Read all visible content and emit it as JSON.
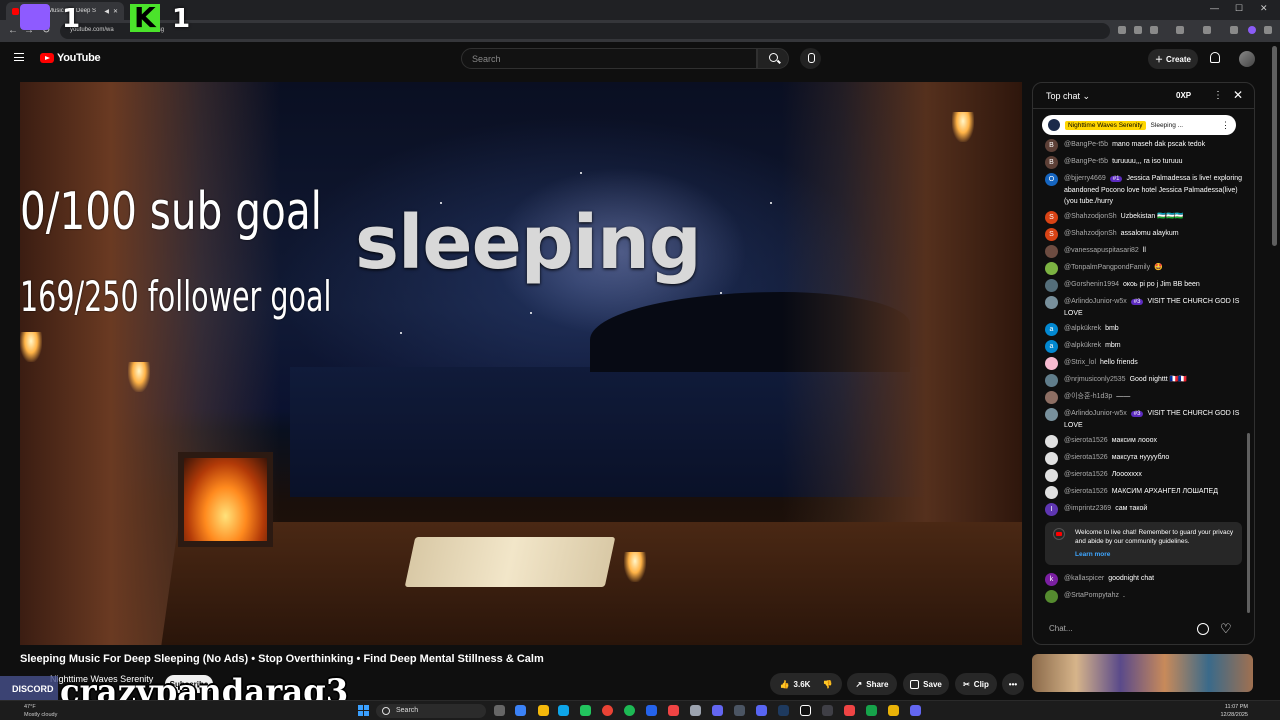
{
  "browser": {
    "tab_title": "Sleeping Music For Deep S",
    "url": "youtube.com/wa",
    "url_tail": "UCI-sg"
  },
  "youtube": {
    "logo": "YouTube",
    "search_placeholder": "Search",
    "create_label": "Create"
  },
  "stream_overlay": {
    "twitch_count": "1",
    "kick_count": "1",
    "sub_goal": "0/100 sub goal",
    "follower_goal": "169/250 follower goal",
    "headline": "sleeping",
    "username": "crazypandarag3",
    "discord_label": "DISCORD"
  },
  "video": {
    "title": "Sleeping Music For Deep Sleeping (No Ads) • Stop Overthinking • Find Deep Mental Stillness & Calm",
    "channel": "Nighttime Waves Serenity",
    "subscribe_label": "Subscribe",
    "likes": "3.6K",
    "share_label": "Share",
    "save_label": "Save",
    "clip_label": "Clip",
    "more_label": "•••"
  },
  "chat": {
    "title": "Top chat",
    "xp": "0XP",
    "pinned_name": "Nighttime Waves Serenity",
    "pinned_text": "Sleeping ...",
    "input_placeholder": "Chat...",
    "welcome_text": "Welcome to live chat! Remember to guard your privacy and abide by our community guidelines.",
    "learn_more": "Learn more",
    "messages": [
      {
        "author": "@BangPe-t5b",
        "text": "mano maseh dak pscak tedok",
        "initial": "B",
        "color": "#5d4037",
        "badge": ""
      },
      {
        "author": "@BangPe-t5b",
        "text": "turuuuu,,, ra iso turuuu",
        "initial": "B",
        "color": "#5d4037",
        "badge": ""
      },
      {
        "author": "@bjjerry4669",
        "text": "Jessica Palmadessa is live! exploring abandoned Pocono love hotel Jessica Palmadessa(live)(you tube./hurry",
        "initial": "O",
        "color": "#1565c0",
        "badge": "#1"
      },
      {
        "author": "@ShahzodjonSh",
        "text": "Uzbekistan 🇺🇿🇺🇿🇺🇿",
        "initial": "S",
        "color": "#d84315",
        "badge": ""
      },
      {
        "author": "@ShahzodjonSh",
        "text": "assalomu alaykum",
        "initial": "S",
        "color": "#d84315",
        "badge": ""
      },
      {
        "author": "@vanessapuspitasari82",
        "text": "ll",
        "initial": "",
        "color": "#6d4c41",
        "badge": ""
      },
      {
        "author": "@TonpalmPangpondFamily",
        "text": "🤩",
        "initial": "",
        "color": "#7cb342",
        "badge": ""
      },
      {
        "author": "@Gorshenin1994",
        "text": "окоь рі ро j Jim BB been",
        "initial": "",
        "color": "#546e7a",
        "badge": ""
      },
      {
        "author": "@ArlindoJunior-w5x",
        "text": "VISIT THE CHURCH GOD IS LOVE",
        "initial": "",
        "color": "#78909c",
        "badge": "#3"
      },
      {
        "author": "@alpkükrek",
        "text": "bmb",
        "initial": "a",
        "color": "#0288d1",
        "badge": ""
      },
      {
        "author": "@alpkükrek",
        "text": "mbm",
        "initial": "a",
        "color": "#0288d1",
        "badge": ""
      },
      {
        "author": "@Strix_lol",
        "text": "hello friends",
        "initial": "",
        "color": "#f8bbd0",
        "badge": ""
      },
      {
        "author": "@nrjmusiconly2535",
        "text": "Good nighttt 🇫🇷🇫🇷",
        "initial": "",
        "color": "#607d8b",
        "badge": ""
      },
      {
        "author": "@이승훈-h1d3p",
        "text": "——",
        "initial": "",
        "color": "#8d6e63",
        "badge": ""
      },
      {
        "author": "@ArlindoJunior-w5x",
        "text": "VISIT THE CHURCH GOD IS LOVE",
        "initial": "",
        "color": "#78909c",
        "badge": "#3"
      },
      {
        "author": "@sierota1526",
        "text": "максим лооох",
        "initial": "",
        "color": "#e0e0e0",
        "badge": ""
      },
      {
        "author": "@sierota1526",
        "text": "максута нуууубло",
        "initial": "",
        "color": "#e0e0e0",
        "badge": ""
      },
      {
        "author": "@sierota1526",
        "text": "Лооохххх",
        "initial": "",
        "color": "#e0e0e0",
        "badge": ""
      },
      {
        "author": "@sierota1526",
        "text": "МАКСИМ АРХАНГЕЛ ЛОШАПЕД",
        "initial": "",
        "color": "#e0e0e0",
        "badge": ""
      },
      {
        "author": "@imprintz2369",
        "text": "сам такой",
        "initial": "I",
        "color": "#5e35b1",
        "badge": ""
      }
    ],
    "after_messages": [
      {
        "author": "@kallaspicer",
        "text": "goodnight chat",
        "initial": "k",
        "color": "#7b1fa2",
        "badge": ""
      },
      {
        "author": "@SrtaPompytahz",
        "text": ".",
        "initial": "",
        "color": "#558b2f",
        "badge": ""
      }
    ]
  },
  "taskbar": {
    "weather_temp": "47°F",
    "weather_text": "Mostly cloudy",
    "search_label": "Search",
    "time": "11:07 PM",
    "date": "12/28/2025"
  }
}
